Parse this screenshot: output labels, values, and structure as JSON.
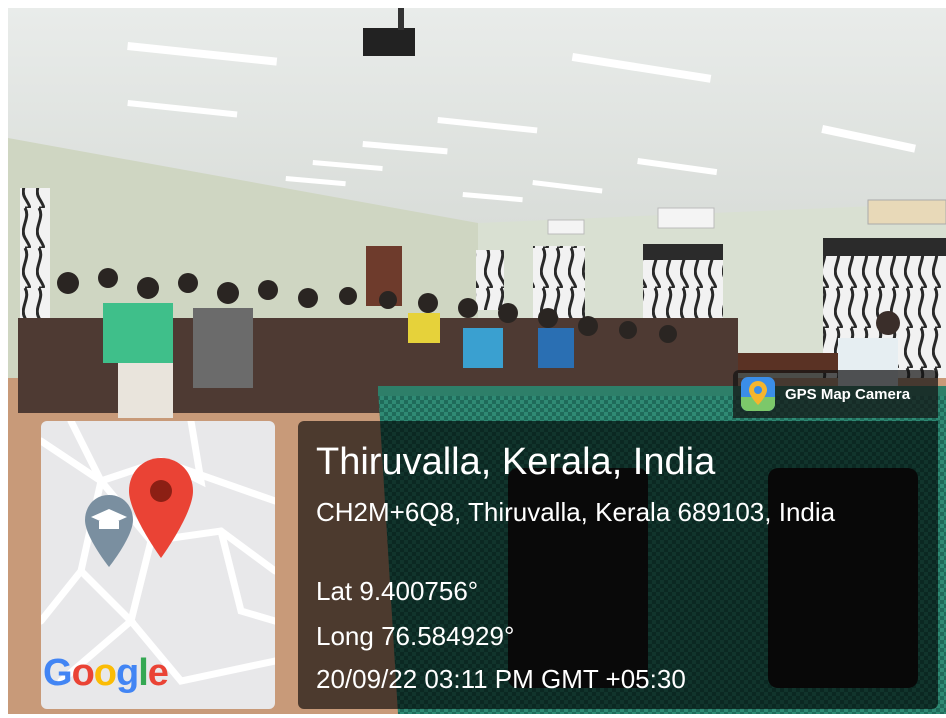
{
  "watermark": {
    "app_name": "GPS Map Camera",
    "app_icon": "map-pin-icon",
    "place_title": "Thiruvalla, Kerala, India",
    "address": "CH2M+6Q8, Thiruvalla, Kerala 689103, India",
    "latitude": "Lat 9.400756°",
    "longitude": "Long 76.584929°",
    "datetime": "20/09/22 03:11 PM GMT +05:30",
    "map": {
      "logo_letters": [
        "G",
        "o",
        "o",
        "g",
        "l",
        "e"
      ],
      "logo_colors": [
        "#4285F4",
        "#EA4335",
        "#FBBC05",
        "#4285F4",
        "#34A853",
        "#EA4335"
      ],
      "pin_color": "#EA4335",
      "poi_icon": "graduation-cap-icon",
      "poi_color": "#7a8fa0"
    }
  }
}
